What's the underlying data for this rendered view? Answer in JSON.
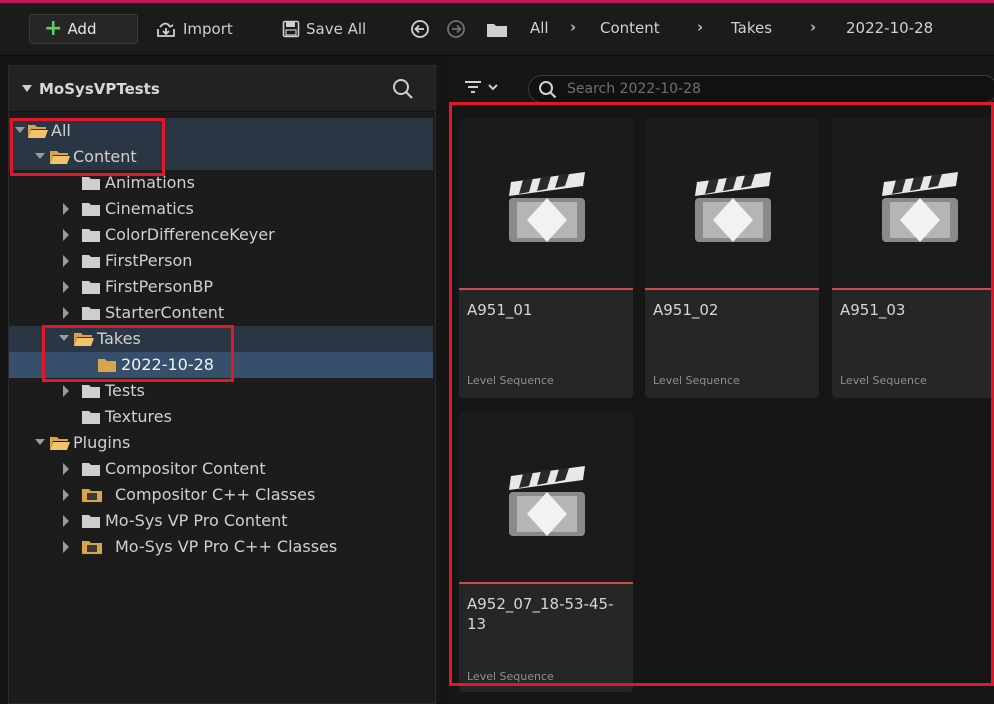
{
  "toolbar": {
    "add_label": "Add",
    "import_label": "Import",
    "save_all_label": "Save All",
    "breadcrumb": [
      "All",
      "Content",
      "Takes",
      "2022-10-28"
    ]
  },
  "sources": {
    "title": "MoSysVPTests",
    "tree": [
      {
        "label": "All"
      },
      {
        "label": "Content"
      },
      {
        "label": "Animations"
      },
      {
        "label": "Cinematics"
      },
      {
        "label": "ColorDifferenceKeyer"
      },
      {
        "label": "FirstPerson"
      },
      {
        "label": "FirstPersonBP"
      },
      {
        "label": "StarterContent"
      },
      {
        "label": "Takes"
      },
      {
        "label": "2022-10-28"
      },
      {
        "label": "Tests"
      },
      {
        "label": "Textures"
      },
      {
        "label": "Plugins"
      },
      {
        "label": "Compositor Content"
      },
      {
        "label": "Compositor C++ Classes"
      },
      {
        "label": "Mo-Sys VP Pro Content"
      },
      {
        "label": "Mo-Sys VP Pro C++ Classes"
      }
    ]
  },
  "content": {
    "search_placeholder": "Search 2022-10-28",
    "assets": [
      {
        "name": "A951_01",
        "type": "Level Sequence"
      },
      {
        "name": "A951_02",
        "type": "Level Sequence"
      },
      {
        "name": "A951_03",
        "type": "Level Sequence"
      },
      {
        "name": "A952_07_18-53-45-13",
        "type": "Level Sequence"
      }
    ]
  },
  "colors": {
    "accent": "#c2185b",
    "selection": "#36506c",
    "folder": "#c8c8c8",
    "open_folder": "#e0b45a",
    "highlight": "#e0182a",
    "asset_stripe": "#d04848"
  }
}
